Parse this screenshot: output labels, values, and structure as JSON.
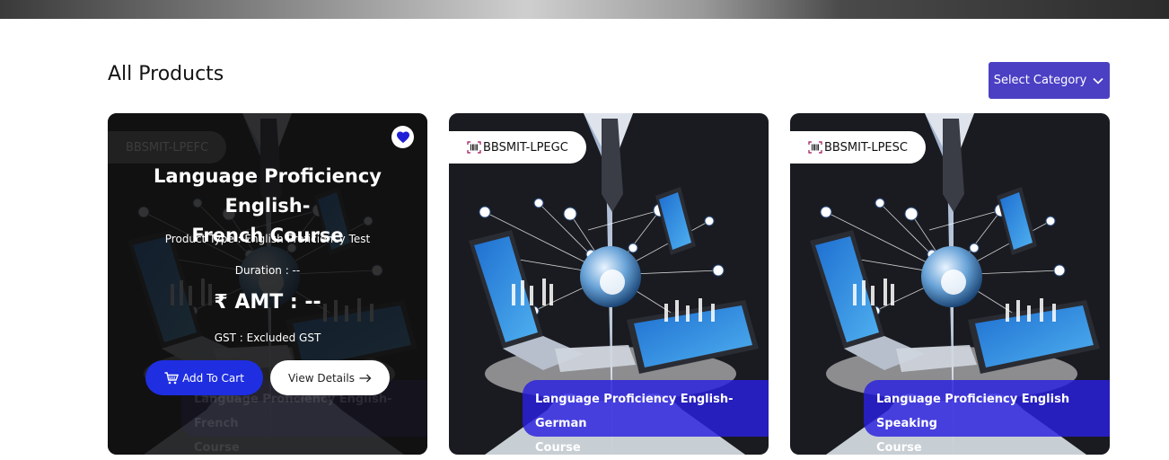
{
  "section": {
    "title": "All Products"
  },
  "category": {
    "label": "Select Category"
  },
  "products": [
    {
      "sku": "BBSMIT-LPEFC",
      "title": "Language Proficiency English-French Course",
      "title_line1": "Language Proficiency English-",
      "title_line2": "French Course",
      "caption_line1": "Language Proficiency English-French",
      "caption_line2": "Course",
      "product_type": "Product Type : English Proficiency Test",
      "duration": "Duration : --",
      "amount": "₹ AMT : --",
      "gst": "GST : Excluded GST",
      "add_to_cart": "Add To Cart",
      "view_details": "View Details"
    },
    {
      "sku": "BBSMIT-LPEGC",
      "caption_line1": "Language Proficiency English-German",
      "caption_line2": "Course"
    },
    {
      "sku": "BBSMIT-LPESC",
      "caption_line1": "Language Proficiency English Speaking",
      "caption_line2": "Course"
    }
  ],
  "icons": {
    "wishlist": "heart-icon",
    "sku": "barcode-icon",
    "cart": "cart-icon",
    "arrow": "arrow-right-icon",
    "dropdown": "chevron-down-icon"
  },
  "colors": {
    "accent": "#4b3fc4",
    "cart_button": "#1e2ee0",
    "caption_bg": "#2a20e1",
    "heart": "#1f1fd6"
  }
}
